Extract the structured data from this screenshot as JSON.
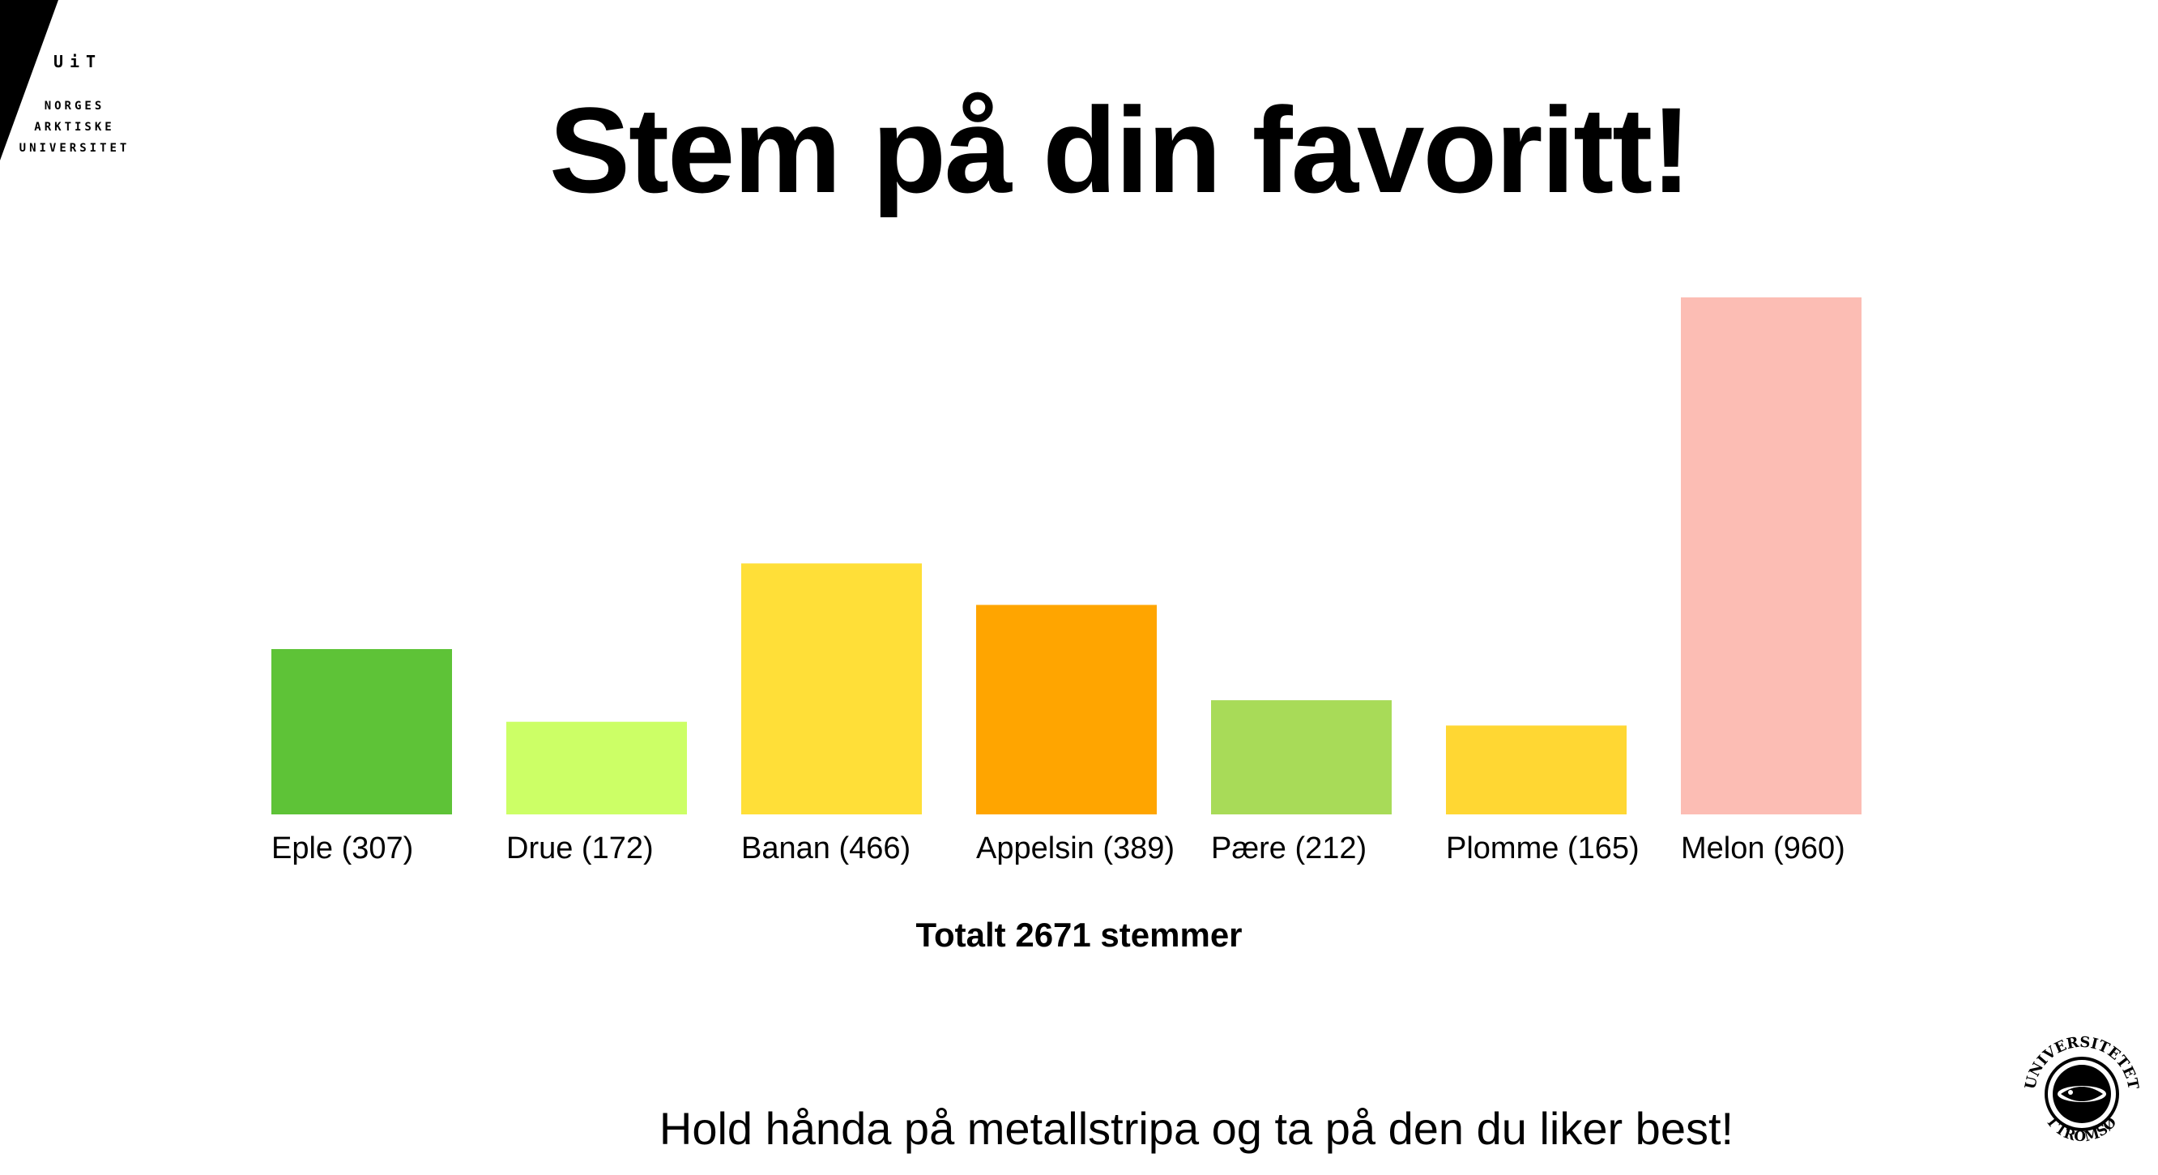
{
  "logo": {
    "abbr": "UiT",
    "lines": [
      "NORGES",
      "ARKTISKE",
      "UNIVERSITET"
    ]
  },
  "title": "Stem på din favoritt!",
  "total_text": "Totalt 2671 stemmer",
  "instruction": "Hold hånda på metallstripa og ta på den du liker best!",
  "seal": {
    "text_top": "UNIVERSITETET",
    "text_bottom": "I TROMSØ"
  },
  "chart_data": {
    "type": "bar",
    "categories": [
      "Eple",
      "Drue",
      "Banan",
      "Appelsin",
      "Pære",
      "Plomme",
      "Melon"
    ],
    "values": [
      307,
      172,
      466,
      389,
      212,
      165,
      960
    ],
    "labels": [
      "Eple (307)",
      "Drue (172)",
      "Banan (466)",
      "Appelsin (389)",
      "Pære (212)",
      "Plomme (165)",
      "Melon (960)"
    ],
    "colors": [
      "#5ec337",
      "#ccff66",
      "#ffdf38",
      "#ffa500",
      "#a8db58",
      "#ffd733",
      "#fcbdb4"
    ],
    "title": "Stem på din favoritt!",
    "xlabel": "",
    "ylabel": "",
    "ylim": [
      0,
      960
    ],
    "grid": false
  }
}
